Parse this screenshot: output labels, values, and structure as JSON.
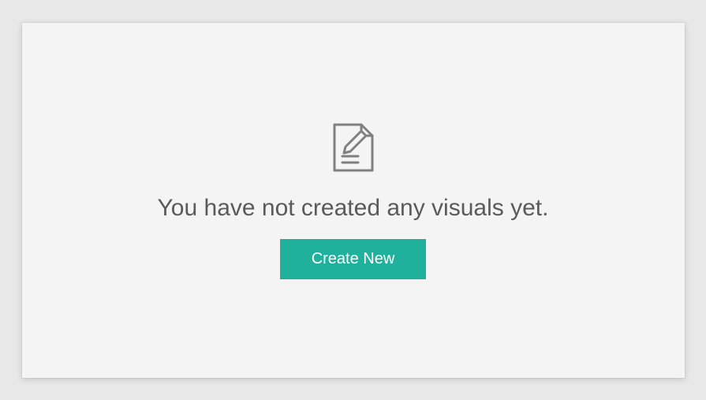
{
  "emptyState": {
    "iconName": "document-edit-icon",
    "message": "You have not created any visuals yet.",
    "buttonLabel": "Create New"
  }
}
